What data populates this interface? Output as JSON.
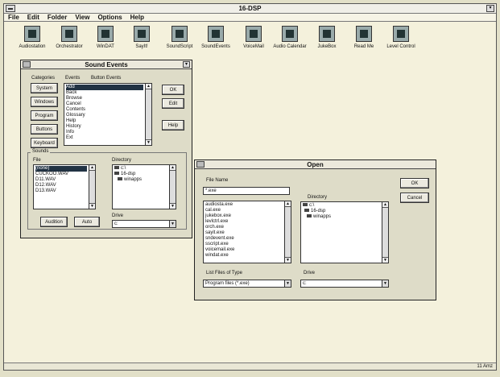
{
  "app": {
    "title": "16-DSP",
    "status_text": "11 Amz"
  },
  "menu": [
    "File",
    "Edit",
    "Folder",
    "View",
    "Options",
    "Help"
  ],
  "toolbar": [
    {
      "label": "Audiostation",
      "icon": "audiostation-icon"
    },
    {
      "label": "Orchestrator",
      "icon": "orchestrator-icon"
    },
    {
      "label": "WinDAT",
      "icon": "windat-icon"
    },
    {
      "label": "SayIt!",
      "icon": "sayit-icon"
    },
    {
      "label": "SoundScript",
      "icon": "soundscript-icon"
    },
    {
      "label": "SoundEvents",
      "icon": "soundevents-icon"
    },
    {
      "label": "VoiceMail",
      "icon": "voicemail-icon"
    },
    {
      "label": "Audio Calendar",
      "icon": "audio-calendar-icon"
    },
    {
      "label": "JukeBox",
      "icon": "jukebox-icon"
    },
    {
      "label": "Read Me",
      "icon": "read-me-icon"
    },
    {
      "label": "Level Control",
      "icon": "level-control-icon"
    }
  ],
  "sound_events": {
    "title": "Sound Events",
    "categories_label": "Categories",
    "events_label": "Events",
    "button_events_label": "Button Events",
    "categories": [
      "System",
      "Windows",
      "Program",
      "Buttons",
      "Keyboard"
    ],
    "events": [
      "Add",
      "Back",
      "Browse",
      "Cancel",
      "Contents",
      "Glossary",
      "Help",
      "History",
      "Info",
      "Ext"
    ],
    "ok": "OK",
    "edit": "Edit",
    "help": "Help",
    "sounds_label": "Sounds",
    "file_label": "File",
    "files": [
      "(none)",
      "CUCKOO.WAV",
      "D11.WAV",
      "D12.WAV",
      "D13.WAV"
    ],
    "directory_label": "Directory",
    "directories": [
      "c:\\",
      "16-dsp",
      "winapps"
    ],
    "drive_label": "Drive",
    "drive_value": "c:",
    "audition": "Audition",
    "auto": "Auto"
  },
  "open_dialog": {
    "title": "Open",
    "filename_label": "File Name",
    "filename_value": "*.exe",
    "files": [
      "audiosta.exe",
      "cal.exe",
      "jukebox.exe",
      "levlctrl.exe",
      "orch.exe",
      "sayit.exe",
      "sndevent.exe",
      "sscript.exe",
      "voicemail.exe",
      "windat.exe"
    ],
    "directory_label": "Directory",
    "directories": [
      "c:\\",
      "16-dsp",
      "winapps"
    ],
    "ok": "OK",
    "cancel": "Cancel",
    "file_type_label": "List Files of Type",
    "file_type_value": "Program files (*.exe)",
    "drive_label": "Drive",
    "drive_value": "c:"
  }
}
